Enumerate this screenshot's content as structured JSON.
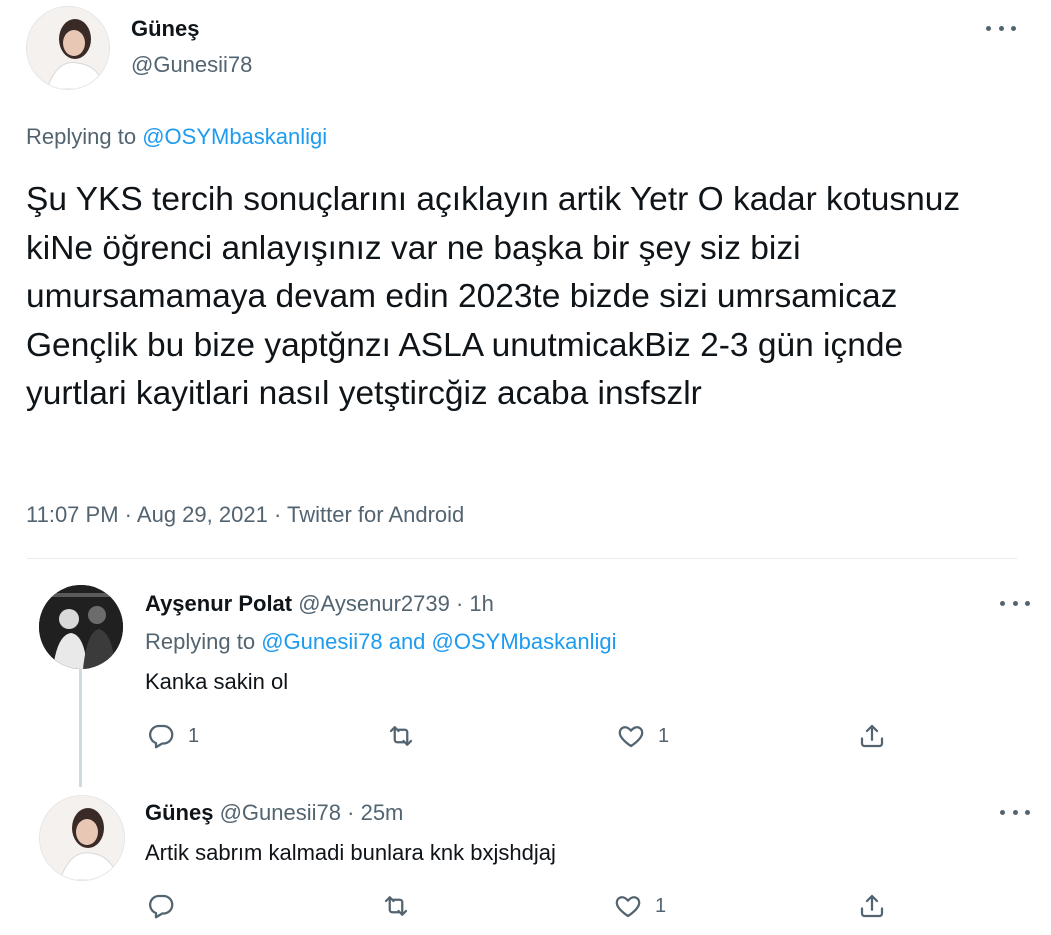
{
  "main_tweet": {
    "name": "Güneş",
    "handle": "@Gunesii78",
    "replying_prefix": "Replying to",
    "replying_to": "@OSYMbaskanligi",
    "text": "Şu YKS tercih sonuçlarını açıklayın artik Yetr O kadar kotusnuz kiNe öğrenci anlayışınız var ne başka bir şey siz bizi umursamamaya devam edin 2023te bizde sizi umrsamicaz Gençlik bu bize yaptğnzı ASLA unutmicakBiz 2-3 gün içnde yurtlari kayitlari nasıl yetştircğiz acaba insfszlr",
    "time": "11:07 PM",
    "sep": "·",
    "date": "Aug 29, 2021",
    "source": "Twitter for Android"
  },
  "replies": [
    {
      "name": "Ayşenur Polat",
      "handle": "@Aysenur2739",
      "sep": "·",
      "time": "1h",
      "replying_prefix": "Replying to",
      "replying_to": "@Gunesii78 and @OSYMbaskanligi",
      "text": "Kanka sakin ol",
      "reply_count": "1",
      "like_count": "1"
    },
    {
      "name": "Güneş",
      "handle": "@Gunesii78",
      "sep": "·",
      "time": "25m",
      "text": "Artik sabrım kalmadi bunlara knk bxjshdjaj",
      "like_count": "1"
    }
  ],
  "icons": [
    "more-icon",
    "reply-icon",
    "retweet-icon",
    "like-icon",
    "share-icon"
  ],
  "colors": {
    "accent": "#1d9bf0",
    "secondary_text": "#536471",
    "thread_line": "#cfd9de"
  }
}
